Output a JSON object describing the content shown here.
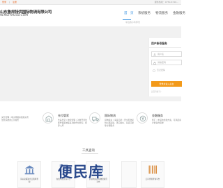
{
  "topbar": {
    "links": [
      "登录",
      "|",
      "注册",
      "欢迎来到..."
    ],
    "phone": "服务热线：0750-6726..."
  },
  "logo": {
    "title": "山东鲁邦特供国际物流有限公司",
    "url": "W.MEIYAO58.COM"
  },
  "nav": {
    "items": [
      {
        "label": "首　页",
        "active": true
      },
      {
        "label": "系统服务",
        "active": false
      },
      {
        "label": "物流服务",
        "active": false
      },
      {
        "label": "金融服务",
        "active": false
      }
    ],
    "subtitle": "平台的小伙伴们"
  },
  "login": {
    "heading": "用户帐号服务",
    "username_placeholder": "用户名",
    "password_placeholder": "请输密码",
    "forgot": "忘记密码",
    "button": "登录并进入后台",
    "hint": "还没有帐号？"
  },
  "features": [
    {
      "title": "",
      "desc": "关务管理丨电子申报系统和关务监管系统的公示服务"
    },
    {
      "title": "仓位管家",
      "desc": "仓品登录丨物流管理丨对账开票智能仓储系统等多功能仓位管家，结算入库"
    },
    {
      "title": "国际物流",
      "desc": "货物报关丨海运订舱丨安全配送提供公路运输、港口拖车、海运订舱等全程服务"
    },
    {
      "title": "金融服务",
      "desc": "结汇丨丰富的金融方案，可满足客户的多样需求"
    }
  ],
  "tools": {
    "title": "工具查询",
    "cards": [
      {
        "label": "海关总署进出口税率查询"
      },
      {
        "label": "在线申报查询平台"
      },
      {
        "label": "跨境电商国际物流资讯平台"
      },
      {
        "label": ""
      },
      {
        "label": "口岸查验查询平台"
      }
    ]
  },
  "watermark": "便民库",
  "colors": {
    "accent": "#2a8be0",
    "login_button": "#f39a1a",
    "topbar_link": "#e9641c"
  }
}
